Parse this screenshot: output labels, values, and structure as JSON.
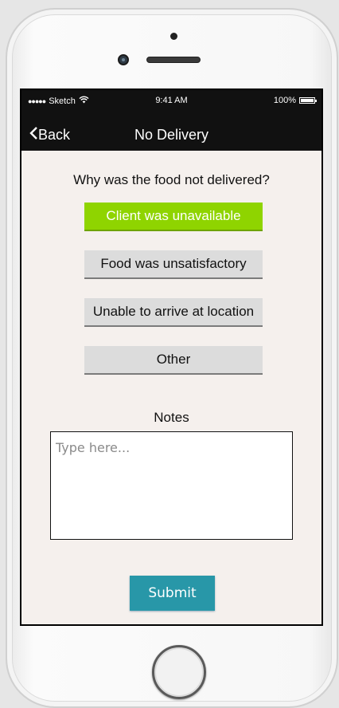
{
  "status_bar": {
    "signal": "●●●●●",
    "carrier": "Sketch",
    "wifi_icon": "wifi-icon",
    "time": "9:41 AM",
    "battery": "100%"
  },
  "nav": {
    "back_icon": "chevron-left-icon",
    "back_label": "Back",
    "title": "No Delivery"
  },
  "form": {
    "question": "Why was the food not delivered?",
    "options": [
      {
        "label": "Client was unavailable",
        "selected": true
      },
      {
        "label": "Food was unsatisfactory",
        "selected": false
      },
      {
        "label": "Unable to arrive at location",
        "selected": false
      },
      {
        "label": "Other",
        "selected": false
      }
    ],
    "notes_label": "Notes",
    "notes_placeholder": "Type here...",
    "notes_value": "",
    "submit_label": "Submit"
  },
  "colors": {
    "selected_option": "#8fd400",
    "option": "#dcdcdc",
    "submit": "#2897a8",
    "nav_background": "#111111",
    "content_background": "#f5f0ed"
  }
}
